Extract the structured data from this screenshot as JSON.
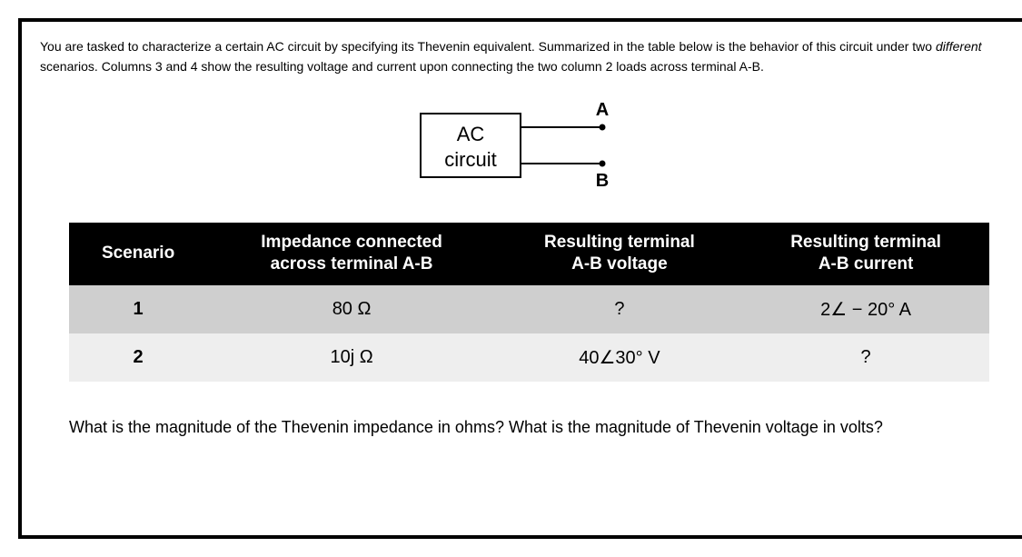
{
  "intro": {
    "line1a": "You are tasked to characterize a certain AC circuit by specifying its Thevenin equivalent. Summarized in the table below is the behavior of this circuit under two ",
    "line2_italic": "different",
    "line2_rest": " scenarios. Columns 3 and 4 show the resulting voltage and current upon connecting the two column 2 loads across terminal A-B."
  },
  "diagram": {
    "box_line1": "AC",
    "box_line2": "circuit",
    "terminal_top": "A",
    "terminal_bottom": "B"
  },
  "table": {
    "headers": {
      "col1": "Scenario",
      "col2a": "Impedance connected",
      "col2b": "across terminal A-B",
      "col3a": "Resulting terminal",
      "col3b": "A-B voltage",
      "col4a": "Resulting terminal",
      "col4b": "A-B current"
    },
    "rows": [
      {
        "scenario": "1",
        "impedance": "80 Ω",
        "voltage": "?",
        "current": "2∠ − 20° A"
      },
      {
        "scenario": "2",
        "impedance": "10j Ω",
        "voltage": "40∠30° V",
        "current": "?"
      }
    ]
  },
  "question": "What is the magnitude of the Thevenin impedance in ohms? What is the magnitude of Thevenin voltage in volts?"
}
